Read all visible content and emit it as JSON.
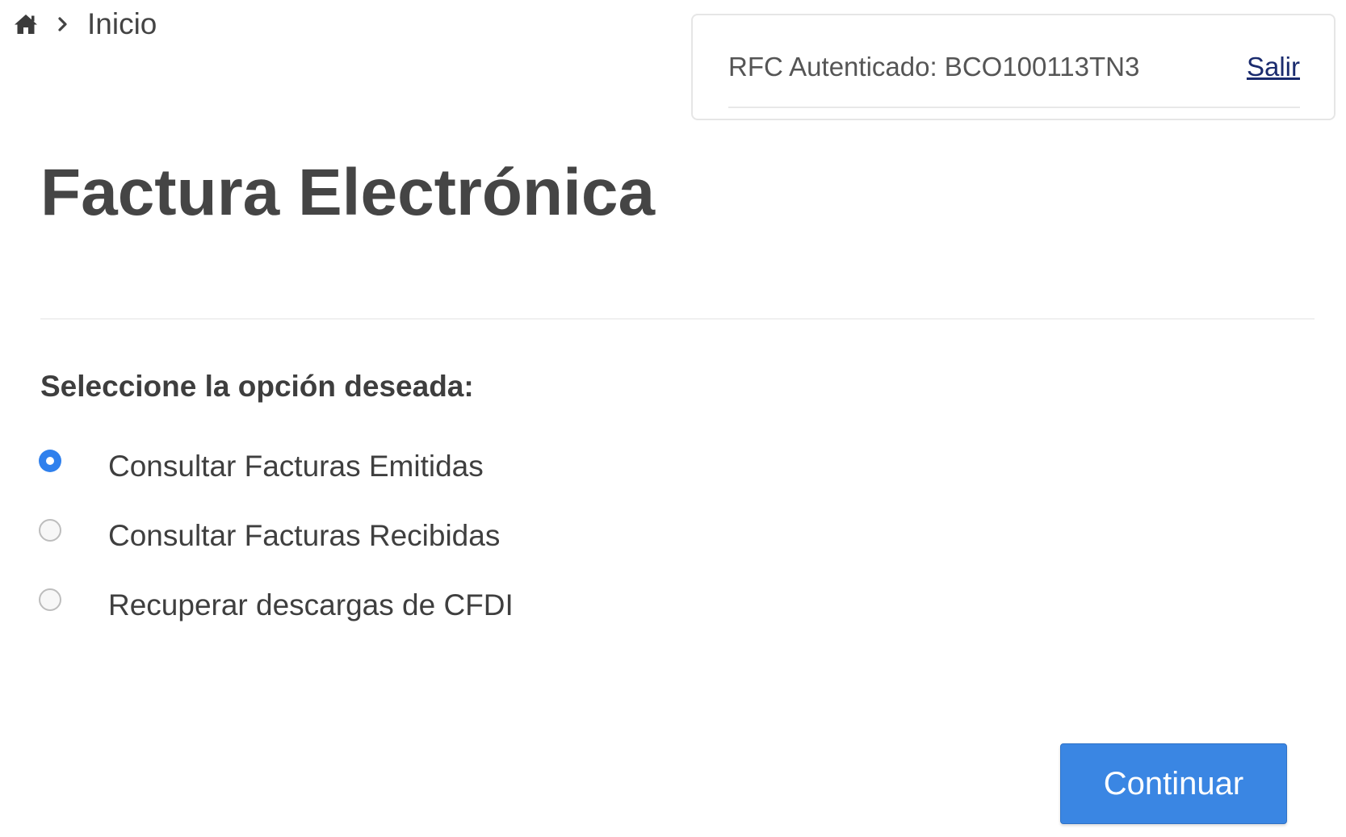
{
  "breadcrumb": {
    "home_icon": "home-icon",
    "separator_icon": "chevron-right-icon",
    "current": "Inicio"
  },
  "auth": {
    "rfc_text": "RFC Autenticado: BCO100113TN3",
    "logout_label": "Salir"
  },
  "page": {
    "title": "Factura Electrónica",
    "prompt": "Seleccione la opción deseada:"
  },
  "options": [
    {
      "label": "Consultar Facturas Emitidas",
      "selected": true
    },
    {
      "label": "Consultar Facturas Recibidas",
      "selected": false
    },
    {
      "label": "Recuperar descargas de CFDI",
      "selected": false
    }
  ],
  "actions": {
    "continue_label": "Continuar"
  },
  "colors": {
    "accent": "#3a86e3",
    "radio_selected": "#2f80ed",
    "link": "#1a2b6e",
    "title_text": "#454545"
  }
}
